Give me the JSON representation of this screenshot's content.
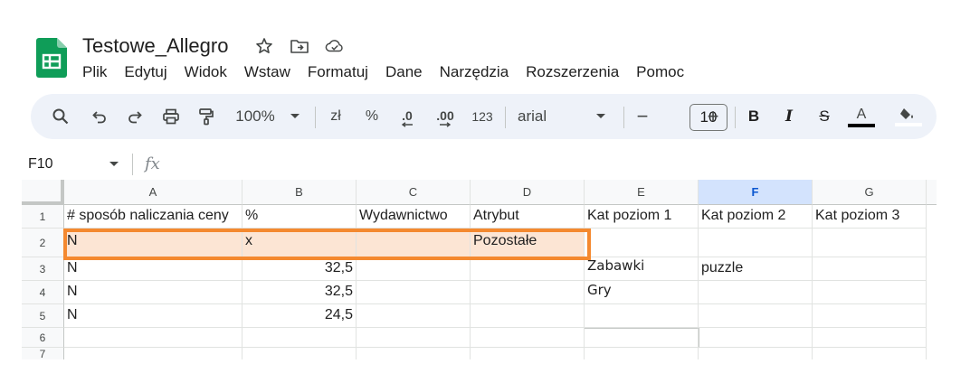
{
  "doc": {
    "title": "Testowe_Allegro",
    "title_icons": [
      "star-icon",
      "move-to-folder-icon",
      "cloud-saved-icon"
    ]
  },
  "menu": [
    "Plik",
    "Edytuj",
    "Widok",
    "Wstaw",
    "Formatuj",
    "Dane",
    "Narzędzia",
    "Rozszerzenia",
    "Pomoc"
  ],
  "toolbar": {
    "zoom": "100%",
    "currency": "zł",
    "percent": "%",
    "dec_less": ".0",
    "dec_more": ".00",
    "number_format": "123",
    "font": "arial",
    "font_size": "10",
    "minus": "−",
    "plus": "+",
    "bold": "B",
    "italic": "I",
    "strike": "S",
    "text_color": "A"
  },
  "formula_bar": {
    "cell_ref": "F10",
    "fx": "fx"
  },
  "grid": {
    "columns": [
      "A",
      "B",
      "C",
      "D",
      "E",
      "F",
      "G"
    ],
    "selected_column": "F",
    "rows": [
      "1",
      "2",
      "3",
      "4",
      "5",
      "6",
      "7"
    ],
    "cells": {
      "r1": [
        "# sposób naliczania ceny",
        "%",
        "Wydawnictwo",
        "Atrybut",
        "Kat poziom 1",
        "Kat poziom 2",
        "Kat poziom 3"
      ],
      "r2": [
        "N",
        "x",
        "",
        "Pozostałe",
        "",
        "",
        ""
      ],
      "r3": [
        "N",
        "32,5",
        "",
        "",
        "Zabawki",
        "puzzle",
        ""
      ],
      "r4": [
        "N",
        "32,5",
        "",
        "",
        "Gry",
        "",
        ""
      ],
      "r5": [
        "N",
        "24,5",
        "",
        "",
        "",
        "",
        ""
      ],
      "r6": [
        "",
        "",
        "",
        "",
        "",
        "",
        ""
      ]
    }
  },
  "colors": {
    "accent": "#0b57d0",
    "highlight_border": "#f4892f",
    "highlight_fill": "#fce5d4",
    "toolbar_bg": "#eef2f9",
    "sheets_green": "#0f9d58"
  }
}
